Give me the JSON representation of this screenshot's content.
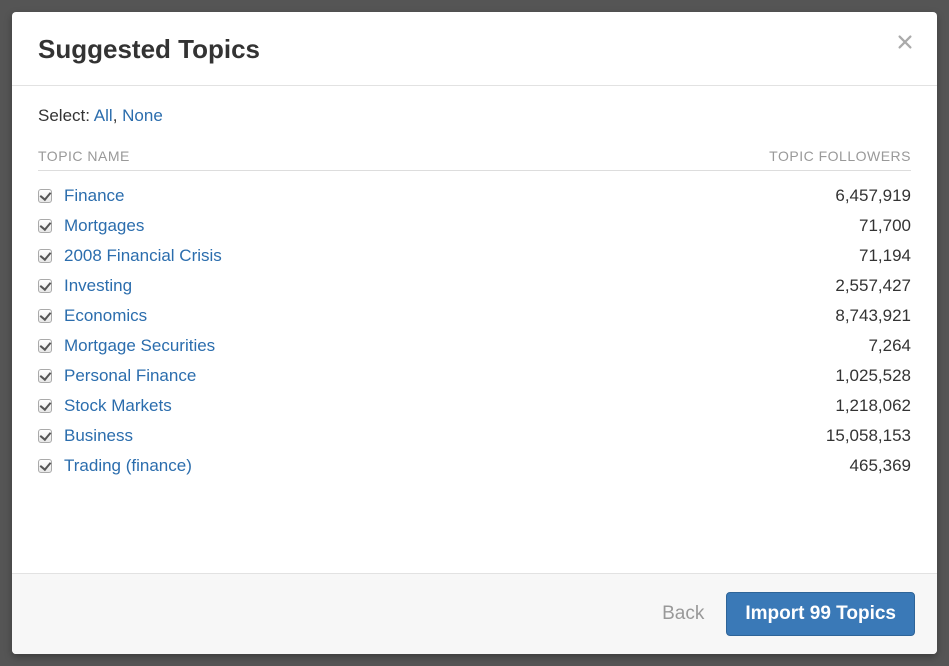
{
  "modal": {
    "title": "Suggested Topics",
    "selectLabel": "Select:",
    "selectAll": "All",
    "selectSeparator": ",",
    "selectNone": "None"
  },
  "table": {
    "header_name": "TOPIC NAME",
    "header_followers": "TOPIC FOLLOWERS"
  },
  "topics": [
    {
      "name": "Finance",
      "followers": "6,457,919"
    },
    {
      "name": "Mortgages",
      "followers": "71,700"
    },
    {
      "name": "2008 Financial Crisis",
      "followers": "71,194"
    },
    {
      "name": "Investing",
      "followers": "2,557,427"
    },
    {
      "name": "Economics",
      "followers": "8,743,921"
    },
    {
      "name": "Mortgage Securities",
      "followers": "7,264"
    },
    {
      "name": "Personal Finance",
      "followers": "1,025,528"
    },
    {
      "name": "Stock Markets",
      "followers": "1,218,062"
    },
    {
      "name": "Business",
      "followers": "15,058,153"
    },
    {
      "name": "Trading (finance)",
      "followers": "465,369"
    }
  ],
  "footer": {
    "back": "Back",
    "import": "Import 99 Topics"
  }
}
